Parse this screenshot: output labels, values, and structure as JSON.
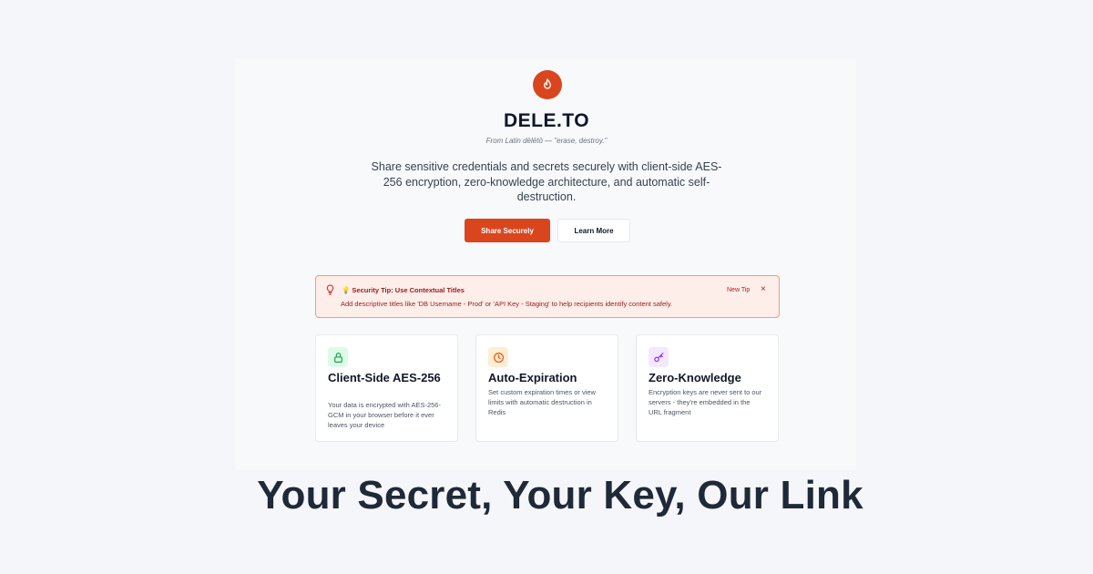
{
  "brand": {
    "name": "DELE.TO",
    "etymology": "From Latin dēlētō — \"erase, destroy.\"",
    "tagline": "Share sensitive credentials and secrets securely with client-side AES-256 encryption, zero-knowledge architecture, and automatic self-destruction.",
    "accent": "#d9461e",
    "logo_icon": "flame-icon"
  },
  "actions": {
    "primary_label": "Share Securely",
    "secondary_label": "Learn More"
  },
  "tip": {
    "icon": "lightbulb-icon",
    "title": "💡 Security Tip: Use Contextual Titles",
    "text": "Add descriptive titles like 'DB Username - Prod' or 'API Key - Staging' to help recipients identify content safely.",
    "new_tip_label": "New Tip",
    "close_label": "×"
  },
  "features": [
    {
      "icon": "lock-icon",
      "title": "Client-Side AES-256",
      "text": "Your data is encrypted with AES-256-GCM in your browser before it ever leaves your device",
      "color": "#16a34a",
      "bg": "#dcfce7"
    },
    {
      "icon": "clock-icon",
      "title": "Auto-Expiration",
      "text": "Set custom expiration times or view limits with automatic destruction in Redis",
      "color": "#ea580c",
      "bg": "#ffedd5"
    },
    {
      "icon": "key-icon",
      "title": "Zero-Knowledge",
      "text": "Encryption keys are never sent to our servers - they're embedded in the URL fragment",
      "color": "#9333ea",
      "bg": "#f3e8ff"
    }
  ],
  "headline": "Your Secret, Your Key, Our Link"
}
